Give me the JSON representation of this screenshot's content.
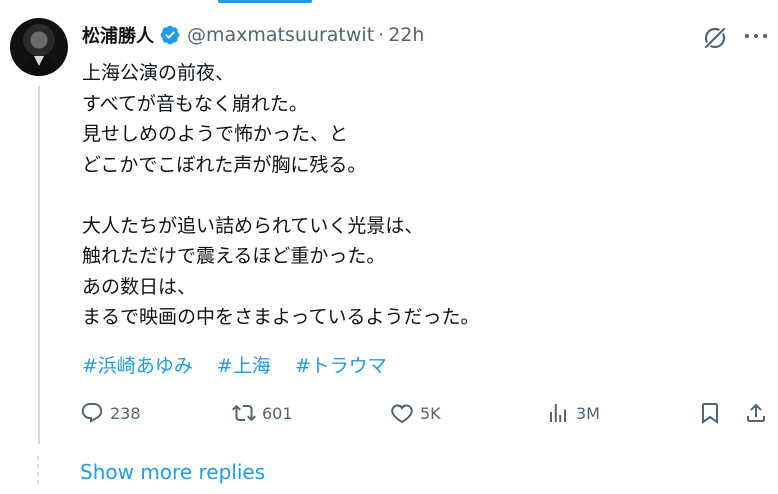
{
  "author": {
    "display_name": "松浦勝人",
    "handle": "@maxmatsuuratwit",
    "separator": "·",
    "time": "22h"
  },
  "tweet": {
    "lines": [
      "上海公演の前夜、",
      "すべてが音もなく崩れた。",
      "見せしめのようで怖かった、と",
      "どこかでこぼれた声が胸に残る。",
      "",
      "大人たちが追い詰められていく光景は、",
      "触れただけで震えるほど重かった。",
      "あの数日は、",
      "まるで映画の中をさまよっているようだった。"
    ],
    "hashtags": [
      "#浜崎あゆみ",
      "#上海",
      "#トラウマ"
    ]
  },
  "actions": {
    "replies": "238",
    "reposts": "601",
    "likes": "5K",
    "views": "3M"
  },
  "thread": {
    "show_more": "Show more replies"
  },
  "icons": {
    "verified": "verified-badge-icon",
    "grok": "grok-icon",
    "more": "more-icon",
    "reply": "reply-icon",
    "repost": "repost-icon",
    "like": "like-icon",
    "views": "views-icon",
    "bookmark": "bookmark-icon",
    "share": "share-icon"
  },
  "colors": {
    "accent": "#1d9bf0",
    "text": "#0f1419",
    "muted": "#536471",
    "line": "#cfd9de"
  }
}
